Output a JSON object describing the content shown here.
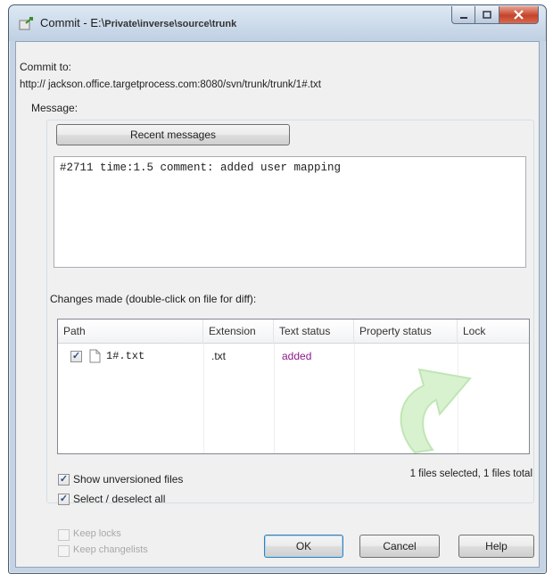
{
  "window": {
    "title": "Commit - E:\\",
    "title_path": "Private\\inverse\\source\\trunk"
  },
  "commit_to": {
    "label": "Commit to:",
    "url": "http://   jackson.office.targetprocess.com:8080/svn/trunk/trunk/1#.txt"
  },
  "message": {
    "label": "Message:",
    "recent_button": "Recent messages",
    "text": "#2711 time:1.5 comment: added user mapping"
  },
  "changes": {
    "label": "Changes made (double-click on file for diff):",
    "columns": [
      "Path",
      "Extension",
      "Text status",
      "Property status",
      "Lock"
    ],
    "rows": [
      {
        "checked": true,
        "path": "1#.txt",
        "extension": ".txt",
        "text_status": "added",
        "property_status": "",
        "lock": ""
      }
    ],
    "summary": "1 files selected, 1 files total"
  },
  "options": {
    "show_unversioned": {
      "label": "Show unversioned files",
      "checked": true
    },
    "select_all": {
      "label": "Select / deselect all",
      "checked": true
    },
    "keep_locks": {
      "label": "Keep locks",
      "checked": false
    },
    "keep_changelists": {
      "label": "Keep changelists",
      "checked": false
    }
  },
  "buttons": {
    "ok": "OK",
    "cancel": "Cancel",
    "help": "Help"
  },
  "colors": {
    "added_status": "#8b1c8b",
    "accent": "#3c7fb1"
  },
  "icons": [
    "svn-commit-icon",
    "minimize-icon",
    "maximize-icon",
    "close-icon",
    "text-file-icon",
    "tortoise-arrow-watermark"
  ]
}
